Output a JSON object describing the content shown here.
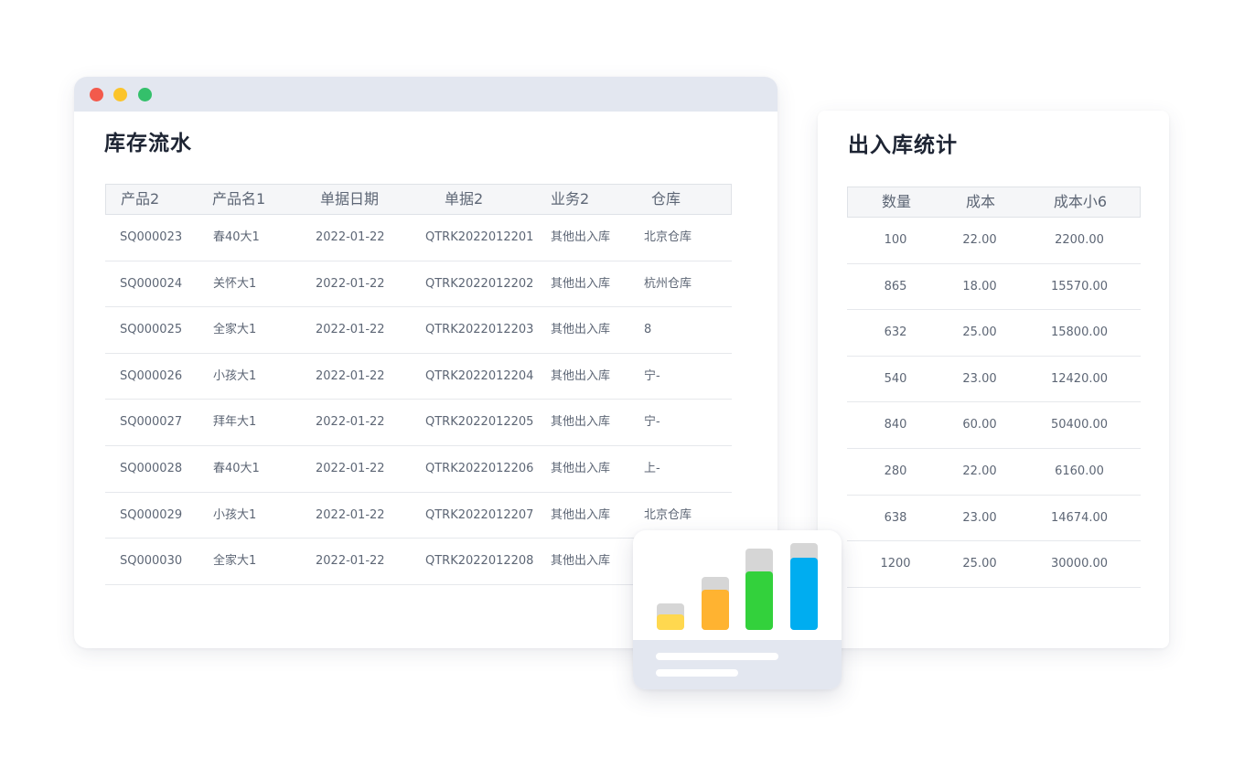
{
  "window_colors": {
    "close": "#f35a4c",
    "minimize": "#fbc42b",
    "maximize": "#34c06b"
  },
  "inventory_flow": {
    "title": "库存流水",
    "columns": [
      "产品2",
      "产品名1",
      "单据日期",
      "单据2",
      "业务2",
      "仓库"
    ],
    "rows": [
      [
        "SQ000023",
        "春40大1",
        "2022-01-22",
        "QTRK2022012201",
        "其他出入库",
        "北京仓库"
      ],
      [
        "SQ000024",
        "关怀大1",
        "2022-01-22",
        "QTRK2022012202",
        "其他出入库",
        "杭州仓库"
      ],
      [
        "SQ000025",
        "全家大1",
        "2022-01-22",
        "QTRK2022012203",
        "其他出入库",
        "8"
      ],
      [
        "SQ000026",
        "小孩大1",
        "2022-01-22",
        "QTRK2022012204",
        "其他出入库",
        "宁-"
      ],
      [
        "SQ000027",
        "拜年大1",
        "2022-01-22",
        "QTRK2022012205",
        "其他出入库",
        "宁-"
      ],
      [
        "SQ000028",
        "春40大1",
        "2022-01-22",
        "QTRK2022012206",
        "其他出入库",
        "上-"
      ],
      [
        "SQ000029",
        "小孩大1",
        "2022-01-22",
        "QTRK2022012207",
        "其他出入库",
        "北京仓库"
      ],
      [
        "SQ000030",
        "全家大1",
        "2022-01-22",
        "QTRK2022012208",
        "其他出入库",
        ""
      ]
    ]
  },
  "inout_stats": {
    "title": "出入库统计",
    "columns": [
      "数量",
      "成本",
      "成本小6"
    ],
    "rows": [
      [
        "100",
        "22.00",
        "2200.00"
      ],
      [
        "865",
        "18.00",
        "15570.00"
      ],
      [
        "632",
        "25.00",
        "15800.00"
      ],
      [
        "540",
        "23.00",
        "12420.00"
      ],
      [
        "840",
        "60.00",
        "50400.00"
      ],
      [
        "280",
        "22.00",
        "6160.00"
      ],
      [
        "638",
        "23.00",
        "14674.00"
      ],
      [
        "1200",
        "25.00",
        "30000.00"
      ]
    ]
  },
  "chart_data": {
    "type": "bar",
    "title": "",
    "xlabel": "",
    "ylabel": "",
    "categories": [
      "",
      "",
      "",
      ""
    ],
    "series": [
      {
        "values": [
          0.17,
          0.44,
          0.64,
          0.79
        ],
        "colors": [
          "#ffd84f",
          "#ffb331",
          "#33d13c",
          "#00adf0"
        ]
      }
    ],
    "backgrounds": [
      0.29,
      0.58,
      0.89,
      0.95
    ],
    "background_color": "#d6d6d6",
    "ylim": [
      0,
      1
    ]
  }
}
